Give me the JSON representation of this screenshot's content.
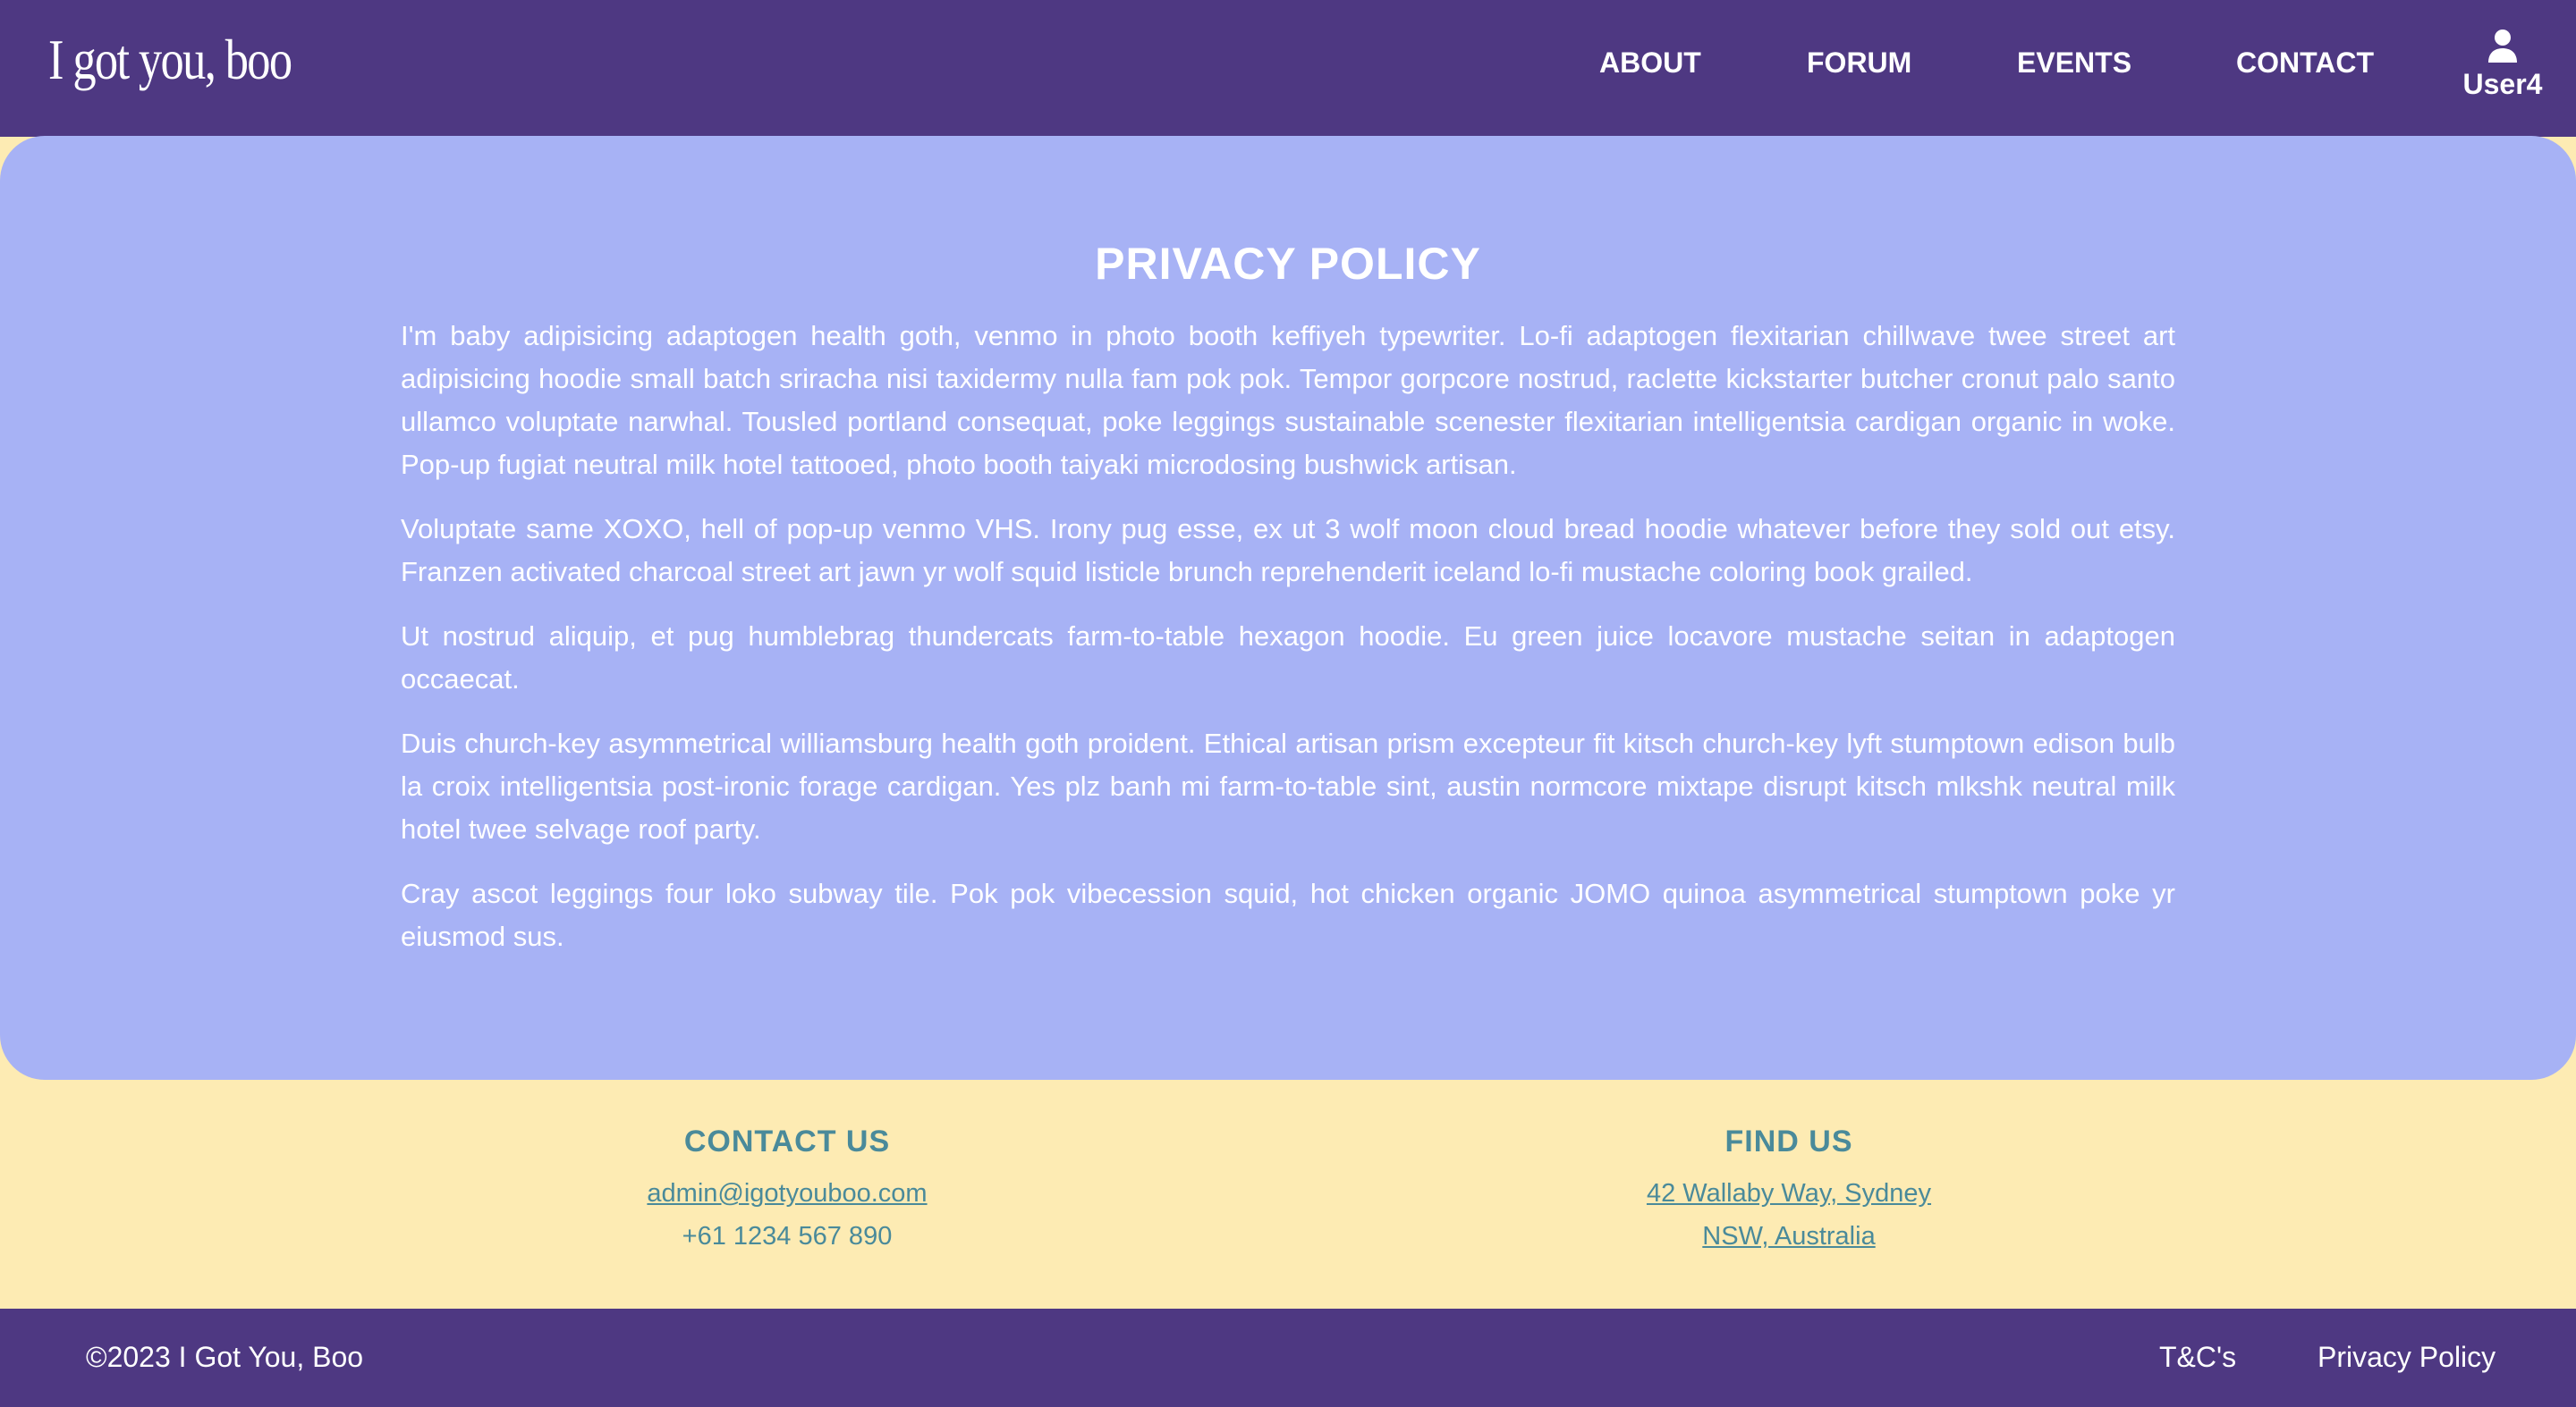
{
  "header": {
    "logo": "I got you, boo",
    "nav": {
      "about": "ABOUT",
      "forum": "FORUM",
      "events": "EVENTS",
      "contact": "CONTACT"
    },
    "user": {
      "icon": "user-icon",
      "label": "User4"
    }
  },
  "main": {
    "title": "PRIVACY POLICY",
    "paragraphs": [
      "I'm baby adipisicing adaptogen health goth, venmo in photo booth keffiyeh typewriter. Lo-fi adaptogen flexitarian chillwave twee street art adipisicing hoodie small batch sriracha nisi taxidermy nulla fam pok pok. Tempor gorpcore nostrud, raclette kickstarter butcher cronut palo santo ullamco voluptate narwhal. Tousled portland consequat, poke leggings sustainable scenester flexitarian intelligentsia cardigan organic in woke. Pop-up fugiat neutral milk hotel tattooed, photo booth taiyaki microdosing bushwick artisan.",
      "Voluptate same XOXO, hell of pop-up venmo VHS. Irony pug esse, ex ut 3 wolf moon cloud bread hoodie whatever before they sold out etsy. Franzen activated charcoal street art jawn yr wolf squid listicle brunch reprehenderit iceland lo-fi mustache coloring book grailed.",
      "Ut nostrud aliquip, et pug humblebrag thundercats farm-to-table hexagon hoodie. Eu green juice locavore mustache seitan in adaptogen occaecat.",
      "Duis church-key asymmetrical williamsburg health goth proident. Ethical artisan prism excepteur fit kitsch church-key lyft stumptown edison bulb la croix intelligentsia post-ironic forage cardigan. Yes plz banh mi farm-to-table sint, austin normcore mixtape disrupt kitsch mlkshk neutral milk hotel twee selvage roof party.",
      "Cray ascot leggings four loko subway tile. Pok pok vibecession squid, hot chicken organic JOMO quinoa asymmetrical stumptown poke yr eiusmod sus."
    ]
  },
  "footer": {
    "contact": {
      "heading": "CONTACT US",
      "email": "admin@igotyouboo.com",
      "phone": "+61 1234 567 890"
    },
    "find": {
      "heading": "FIND US",
      "address_line1": "42 Wallaby Way, Sydney",
      "address_line2": "NSW, Australia"
    }
  },
  "bottom_bar": {
    "copyright": "©2023 I Got You, Boo",
    "links": {
      "terms": "T&C's",
      "privacy": "Privacy Policy"
    }
  },
  "colors": {
    "header_bg": "#4e3882",
    "main_bg": "#a7b2f5",
    "footer_bg": "#fdebb3",
    "footer_text": "#4a8a9a",
    "text_light": "#ffffff"
  }
}
